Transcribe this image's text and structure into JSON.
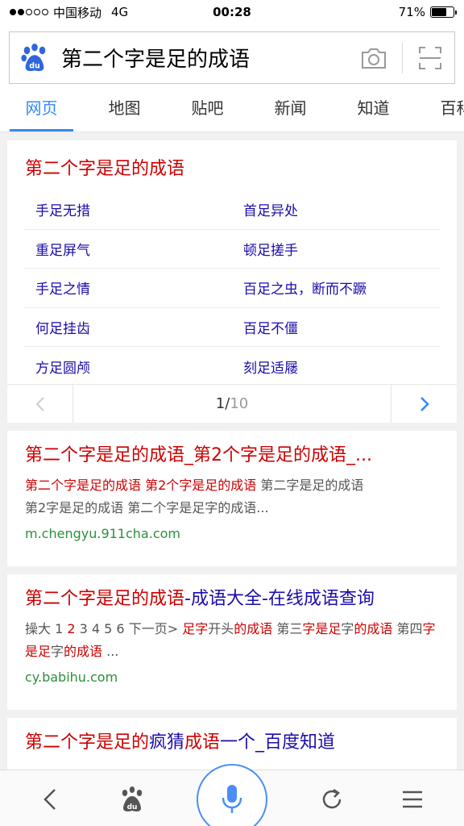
{
  "status_bar": {
    "carrier": "中国移动",
    "network": "4G",
    "time": "00:28",
    "battery": "71%",
    "battery_level": 0.71
  },
  "search": {
    "query": "第二个字是足的成语"
  },
  "tabs": [
    {
      "label": "网页",
      "active": true
    },
    {
      "label": "地图"
    },
    {
      "label": "贴吧"
    },
    {
      "label": "新闻"
    },
    {
      "label": "知道"
    },
    {
      "label": "百科"
    }
  ],
  "idiom_card": {
    "title": "第二个字是足的成语",
    "rows": [
      [
        "手足无措",
        "首足异处"
      ],
      [
        "重足屏气",
        "顿足搓手"
      ],
      [
        "手足之情",
        "百足之虫，断而不蹶"
      ],
      [
        "何足挂齿",
        "百足不僵"
      ],
      [
        "方足圆颅",
        "刻足适屦"
      ]
    ],
    "page_current": "1",
    "page_separator": "/",
    "page_total": "10"
  },
  "results": [
    {
      "title": "第二个字是足的成语_第2个字是足的成语_...",
      "snippet_line1_red": "第二个字是足的成语 第2个字是足的成语",
      "snippet_line1_plain": " 第二字是足的成语",
      "snippet_line2": "第2字是足的成语 第二个字是足字的成语...",
      "url": "m.chengyu.911cha.com"
    },
    {
      "title_red": "第二个字是足的成语",
      "title_blue": "-成语大全-在线成语查询",
      "snippet": {
        "a": "操大 1 ",
        "b": "2",
        "c": " 3 4 5 6 下一页> ",
        "d": "足字",
        "e": "开头",
        "f": "的成语",
        "g": " 第三",
        "h": "字是足",
        "i": "字",
        "j": "的成语",
        "k": " 第四",
        "l": "字是足",
        "m": "字",
        "n": "的成语",
        "o": " ..."
      },
      "url": "cy.babihu.com"
    },
    {
      "title_red1": "第二个字是足的",
      "title_blue1": "疯猜",
      "title_red2": "成语",
      "title_blue2": "一个_百度知道"
    }
  ],
  "toolbar": {
    "icons": [
      "back-icon",
      "baidu-paw-icon",
      "microphone-icon",
      "refresh-icon",
      "menu-icon"
    ]
  },
  "colors": {
    "accent": "#3388ff",
    "title_red": "#cc0000",
    "link_blue": "#1a0dab",
    "url_green": "#2d8e3c"
  }
}
